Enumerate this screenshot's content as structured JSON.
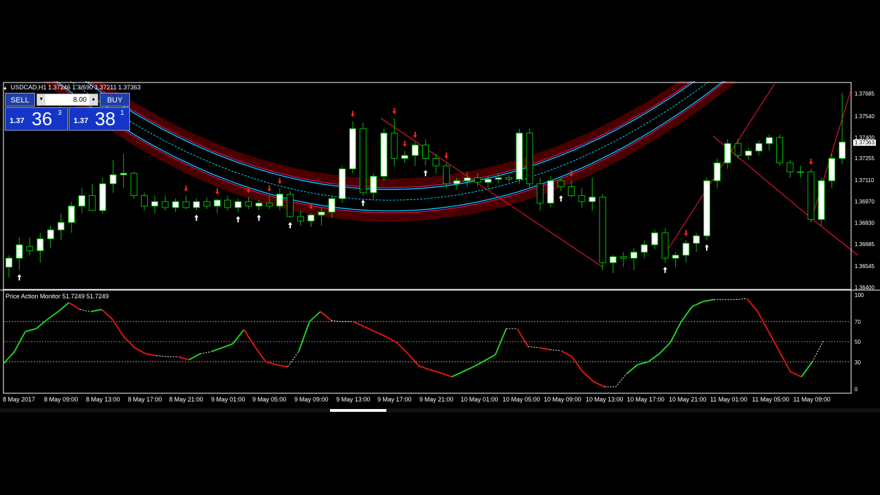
{
  "header": {
    "symbol": "USDCAD,H1",
    "open": "1.37246",
    "high": "1.3/690",
    "low": "1.37211",
    "close": "1.37363"
  },
  "trade_panel": {
    "sell_label": "SELL",
    "buy_label": "BUY",
    "lot_size": "8.00",
    "sell_price": {
      "small": "1.37",
      "big": "36",
      "sup": "3"
    },
    "buy_price": {
      "small": "1.37",
      "big": "38",
      "sup": "1"
    }
  },
  "indicator": {
    "name": "Price Action Monitor",
    "value1": "51.7249",
    "value2": "51.7249"
  },
  "price_axis": {
    "labels": [
      "1.37685",
      "1.37540",
      "1.37400",
      "1.37255",
      "1.37110",
      "1.36970",
      "1.36830",
      "1.36685",
      "1.36545",
      "1.36400"
    ],
    "current_price": "1.37363"
  },
  "osc_axis": {
    "labels": [
      "100",
      "70",
      "50",
      "30",
      "0"
    ]
  },
  "time_axis": {
    "labels": [
      "8 May 2017",
      "8 May 09:00",
      "8 May 13:00",
      "8 May 17:00",
      "8 May 21:00",
      "9 May 01:00",
      "9 May 05:00",
      "9 May 09:00",
      "9 May 13:00",
      "9 May 17:00",
      "9 May 21:00",
      "10 May 01:00",
      "10 May 05:00",
      "10 May 09:00",
      "10 May 13:00",
      "10 May 17:00",
      "10 May 21:00",
      "11 May 01:00",
      "11 May 05:00",
      "11 May 09:00"
    ]
  },
  "colors": {
    "bull_candle": "#ffffff",
    "bear_candle": "#000000",
    "wick": "#00c000",
    "channel_cyan": "#00e0ff",
    "channel_red": "#ff1a3a",
    "channel_fill_red": "#4a0000",
    "channel_fill_blue": "#000050",
    "osc_up": "#22d022",
    "osc_down": "#e01414",
    "arrow_up": "#ffffff",
    "arrow_down": "#ff2020"
  },
  "chart_data": {
    "type": "candlestick",
    "symbol": "USDCAD",
    "timeframe": "H1",
    "ylim": [
      1.3637,
      1.3776
    ],
    "candles": [
      [
        1.3652,
        1.366,
        1.3645,
        1.3658
      ],
      [
        1.3658,
        1.3672,
        1.365,
        1.3667
      ],
      [
        1.3666,
        1.3672,
        1.366,
        1.3663
      ],
      [
        1.3663,
        1.3675,
        1.3655,
        1.3671
      ],
      [
        1.3671,
        1.368,
        1.3665,
        1.3677
      ],
      [
        1.3677,
        1.3688,
        1.367,
        1.3682
      ],
      [
        1.3682,
        1.3696,
        1.3675,
        1.3693
      ],
      [
        1.3693,
        1.3705,
        1.3688,
        1.37
      ],
      [
        1.37,
        1.3708,
        1.369,
        1.369
      ],
      [
        1.369,
        1.3712,
        1.3688,
        1.3708
      ],
      [
        1.3708,
        1.3724,
        1.3702,
        1.3714
      ],
      [
        1.3714,
        1.3728,
        1.3705,
        1.3715
      ],
      [
        1.3715,
        1.3716,
        1.3698,
        1.37
      ],
      [
        1.37,
        1.3702,
        1.369,
        1.3693
      ],
      [
        1.3693,
        1.37,
        1.3688,
        1.3696
      ],
      [
        1.3696,
        1.37,
        1.369,
        1.3692
      ],
      [
        1.3692,
        1.3698,
        1.3689,
        1.3696
      ],
      [
        1.3696,
        1.37,
        1.3691,
        1.3692
      ],
      [
        1.3692,
        1.3698,
        1.369,
        1.3696
      ],
      [
        1.3696,
        1.3699,
        1.3691,
        1.3693
      ],
      [
        1.3693,
        1.3698,
        1.3688,
        1.3697
      ],
      [
        1.3697,
        1.37,
        1.369,
        1.3692
      ],
      [
        1.3692,
        1.3698,
        1.3689,
        1.3696
      ],
      [
        1.3696,
        1.3699,
        1.3691,
        1.3693
      ],
      [
        1.3693,
        1.3697,
        1.369,
        1.3695
      ],
      [
        1.3695,
        1.37,
        1.3691,
        1.3693
      ],
      [
        1.3693,
        1.3705,
        1.369,
        1.3701
      ],
      [
        1.3701,
        1.3703,
        1.3685,
        1.3686
      ],
      [
        1.3686,
        1.369,
        1.368,
        1.3683
      ],
      [
        1.3683,
        1.3688,
        1.3679,
        1.3687
      ],
      [
        1.3687,
        1.3692,
        1.368,
        1.3689
      ],
      [
        1.3689,
        1.37,
        1.3685,
        1.3698
      ],
      [
        1.3698,
        1.372,
        1.3695,
        1.3718
      ],
      [
        1.3718,
        1.375,
        1.3715,
        1.3745
      ],
      [
        1.3745,
        1.3749,
        1.37,
        1.3702
      ],
      [
        1.3702,
        1.3715,
        1.3698,
        1.3713
      ],
      [
        1.3713,
        1.3745,
        1.371,
        1.3742
      ],
      [
        1.3742,
        1.3752,
        1.372,
        1.3725
      ],
      [
        1.3725,
        1.373,
        1.3722,
        1.3727
      ],
      [
        1.3727,
        1.3736,
        1.372,
        1.3734
      ],
      [
        1.3734,
        1.3738,
        1.372,
        1.3725
      ],
      [
        1.3725,
        1.3728,
        1.3715,
        1.372
      ],
      [
        1.372,
        1.3722,
        1.3705,
        1.3708
      ],
      [
        1.3708,
        1.3712,
        1.3704,
        1.371
      ],
      [
        1.371,
        1.3716,
        1.3706,
        1.3712
      ],
      [
        1.3712,
        1.3715,
        1.3706,
        1.3709
      ],
      [
        1.3709,
        1.3713,
        1.3705,
        1.3711
      ],
      [
        1.3711,
        1.3715,
        1.3708,
        1.3712
      ],
      [
        1.3712,
        1.3714,
        1.3709,
        1.3711
      ],
      [
        1.3711,
        1.3745,
        1.3708,
        1.3742
      ],
      [
        1.3742,
        1.3745,
        1.3705,
        1.3708
      ],
      [
        1.3708,
        1.3712,
        1.369,
        1.3695
      ],
      [
        1.3695,
        1.3713,
        1.3692,
        1.371
      ],
      [
        1.371,
        1.3712,
        1.3703,
        1.3706
      ],
      [
        1.3706,
        1.371,
        1.3699,
        1.37
      ],
      [
        1.37,
        1.3705,
        1.3692,
        1.3696
      ],
      [
        1.3696,
        1.3712,
        1.369,
        1.3699
      ],
      [
        1.3699,
        1.3701,
        1.365,
        1.3655
      ],
      [
        1.3655,
        1.366,
        1.3648,
        1.3659
      ],
      [
        1.3659,
        1.3662,
        1.3652,
        1.3658
      ],
      [
        1.3658,
        1.3665,
        1.365,
        1.3662
      ],
      [
        1.3662,
        1.367,
        1.3658,
        1.3667
      ],
      [
        1.3667,
        1.3677,
        1.3664,
        1.3675
      ],
      [
        1.3675,
        1.3678,
        1.3655,
        1.3658
      ],
      [
        1.3658,
        1.3662,
        1.3652,
        1.366
      ],
      [
        1.366,
        1.367,
        1.3655,
        1.3668
      ],
      [
        1.3668,
        1.3675,
        1.3662,
        1.3673
      ],
      [
        1.3673,
        1.3712,
        1.367,
        1.371
      ],
      [
        1.371,
        1.3725,
        1.3705,
        1.3722
      ],
      [
        1.3722,
        1.3738,
        1.3718,
        1.3735
      ],
      [
        1.3735,
        1.3738,
        1.3725,
        1.3727
      ],
      [
        1.3727,
        1.3732,
        1.3724,
        1.373
      ],
      [
        1.373,
        1.3737,
        1.3727,
        1.3735
      ],
      [
        1.3735,
        1.3741,
        1.373,
        1.3739
      ],
      [
        1.3739,
        1.3741,
        1.372,
        1.3722
      ],
      [
        1.3722,
        1.3724,
        1.3712,
        1.3716
      ],
      [
        1.3716,
        1.372,
        1.3712,
        1.3716
      ],
      [
        1.3716,
        1.3718,
        1.3682,
        1.3684
      ],
      [
        1.3684,
        1.3712,
        1.368,
        1.371
      ],
      [
        1.371,
        1.3728,
        1.3705,
        1.3725
      ],
      [
        1.3725,
        1.3769,
        1.3721,
        1.3736
      ]
    ],
    "arrows": [
      {
        "i": 1,
        "dir": "up"
      },
      {
        "i": 17,
        "dir": "down"
      },
      {
        "i": 18,
        "dir": "up"
      },
      {
        "i": 20,
        "dir": "down"
      },
      {
        "i": 22,
        "dir": "up"
      },
      {
        "i": 23,
        "dir": "down"
      },
      {
        "i": 24,
        "dir": "up"
      },
      {
        "i": 25,
        "dir": "down"
      },
      {
        "i": 26,
        "dir": "down"
      },
      {
        "i": 27,
        "dir": "up"
      },
      {
        "i": 29,
        "dir": "down"
      },
      {
        "i": 33,
        "dir": "down"
      },
      {
        "i": 34,
        "dir": "up"
      },
      {
        "i": 37,
        "dir": "down"
      },
      {
        "i": 38,
        "dir": "down"
      },
      {
        "i": 39,
        "dir": "down"
      },
      {
        "i": 40,
        "dir": "up"
      },
      {
        "i": 42,
        "dir": "down"
      },
      {
        "i": 53,
        "dir": "up"
      },
      {
        "i": 54,
        "dir": "down"
      },
      {
        "i": 63,
        "dir": "up"
      },
      {
        "i": 65,
        "dir": "down"
      },
      {
        "i": 67,
        "dir": "up"
      },
      {
        "i": 77,
        "dir": "down"
      }
    ],
    "oscillator": {
      "ylim": [
        0,
        100
      ],
      "levels": [
        70,
        50,
        30
      ],
      "values": [
        28,
        40,
        60,
        63,
        72,
        80,
        89,
        82,
        80,
        82,
        72,
        55,
        44,
        38,
        36,
        35,
        35,
        32,
        38,
        40,
        44,
        48,
        62,
        45,
        30,
        27,
        25,
        40,
        70,
        80,
        71,
        70,
        70,
        65,
        60,
        55,
        49,
        38,
        26,
        22,
        19,
        15,
        20,
        25,
        31,
        37,
        63,
        63,
        45,
        44,
        42,
        41,
        35,
        20,
        10,
        5,
        5,
        18,
        27,
        30,
        38,
        49,
        70,
        85,
        90,
        92,
        92,
        92,
        93,
        80,
        60,
        40,
        20,
        15,
        30,
        51
      ]
    }
  }
}
